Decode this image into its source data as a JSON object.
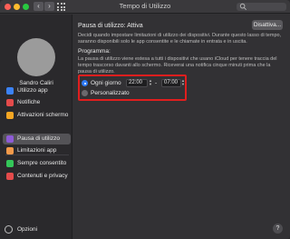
{
  "window": {
    "title": "Tempo di Utilizzo",
    "nav_back": "‹",
    "nav_forward": "›",
    "search_placeholder": ""
  },
  "sidebar": {
    "username": "Sandro Caliri",
    "items": [
      {
        "label": "Utilizzo app",
        "icon": "hourglass-icon",
        "color": "#3b82f6"
      },
      {
        "label": "Notifiche",
        "icon": "notifications-icon",
        "color": "#e44b4b"
      },
      {
        "label": "Attivazioni schermo",
        "icon": "pickups-icon",
        "color": "#f5a623"
      },
      {
        "label": "Pausa di utilizzo",
        "icon": "downtime-icon",
        "color": "#8e5bd6"
      },
      {
        "label": "Limitazioni app",
        "icon": "app-limits-icon",
        "color": "#f2994a"
      },
      {
        "label": "Sempre consentito",
        "icon": "always-allowed-icon",
        "color": "#34c759"
      },
      {
        "label": "Contenuti e privacy",
        "icon": "content-privacy-icon",
        "color": "#e44b4b"
      }
    ],
    "options_label": "Opzioni"
  },
  "main": {
    "status_text": "Pausa di utilizzo: Attiva",
    "disable_button": "Disattiva...",
    "description": "Decidi quando impostare limitazioni di utilizzo dei dispositivi. Durante questo lasso di tempo, saranno disponibili solo le app consentite e le chiamate in entrata e in uscita.",
    "schedule_title": "Programma:",
    "schedule_desc": "La pausa di utilizzo viene estesa a tutti i dispositivi che usano iCloud per tenere traccia del tempo trascorso davanti allo schermo. Riceverai una notifica cinque minuti prima che la pausa di utilizzo.",
    "every_day_label": "Ogni giorno",
    "start_time": "22:00",
    "dash": "-",
    "end_time": "07:00",
    "custom_label": "Personalizzato",
    "selected_option": "Ogni giorno",
    "help": "?"
  }
}
